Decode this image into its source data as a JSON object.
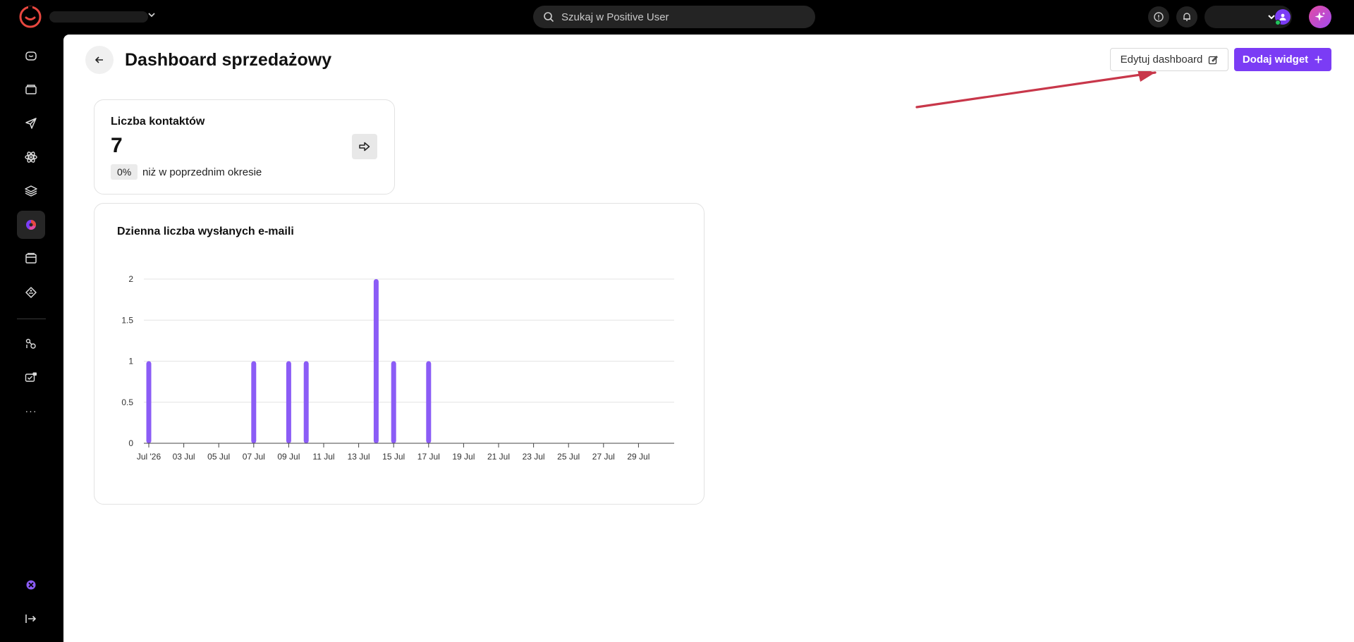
{
  "topbar": {
    "search_placeholder": "Szukaj w Positive User"
  },
  "page": {
    "title": "Dashboard sprzedażowy",
    "edit_label": "Edytuj dashboard",
    "add_label": "Dodaj widget"
  },
  "contacts_widget": {
    "title": "Liczba kontaktów",
    "value": "7",
    "badge": "0%",
    "subtitle": "niż w poprzednim okresie"
  },
  "sidebar": {
    "items": [
      "home-icon",
      "folder-icon",
      "send-icon",
      "atom-icon",
      "layers-icon",
      "analytics-icon",
      "window-icon",
      "tag-icon",
      "automation-icon",
      "chat-icon",
      "more-icon"
    ],
    "more_label": "···"
  },
  "colors": {
    "accent": "#7b3cf5",
    "bar": "#8b5cf6",
    "annotation_arrow": "#c8374a"
  },
  "chart_data": {
    "type": "bar",
    "title": "Dzienna liczba wysłanych e-maili",
    "x_tick_labels": [
      "Jul '26",
      "03 Jul",
      "05 Jul",
      "07 Jul",
      "09 Jul",
      "11 Jul",
      "13 Jul",
      "15 Jul",
      "17 Jul",
      "19 Jul",
      "21 Jul",
      "23 Jul",
      "25 Jul",
      "27 Jul",
      "29 Jul"
    ],
    "y_tick_labels": [
      "0",
      "0.5",
      "1",
      "1.5",
      "2"
    ],
    "x_days": [
      1,
      7,
      9,
      10,
      14,
      15,
      17
    ],
    "values": [
      1,
      1,
      1,
      1,
      2,
      1,
      1
    ],
    "xlim": [
      1,
      31
    ],
    "ylim": [
      0,
      2
    ],
    "grid": true
  }
}
